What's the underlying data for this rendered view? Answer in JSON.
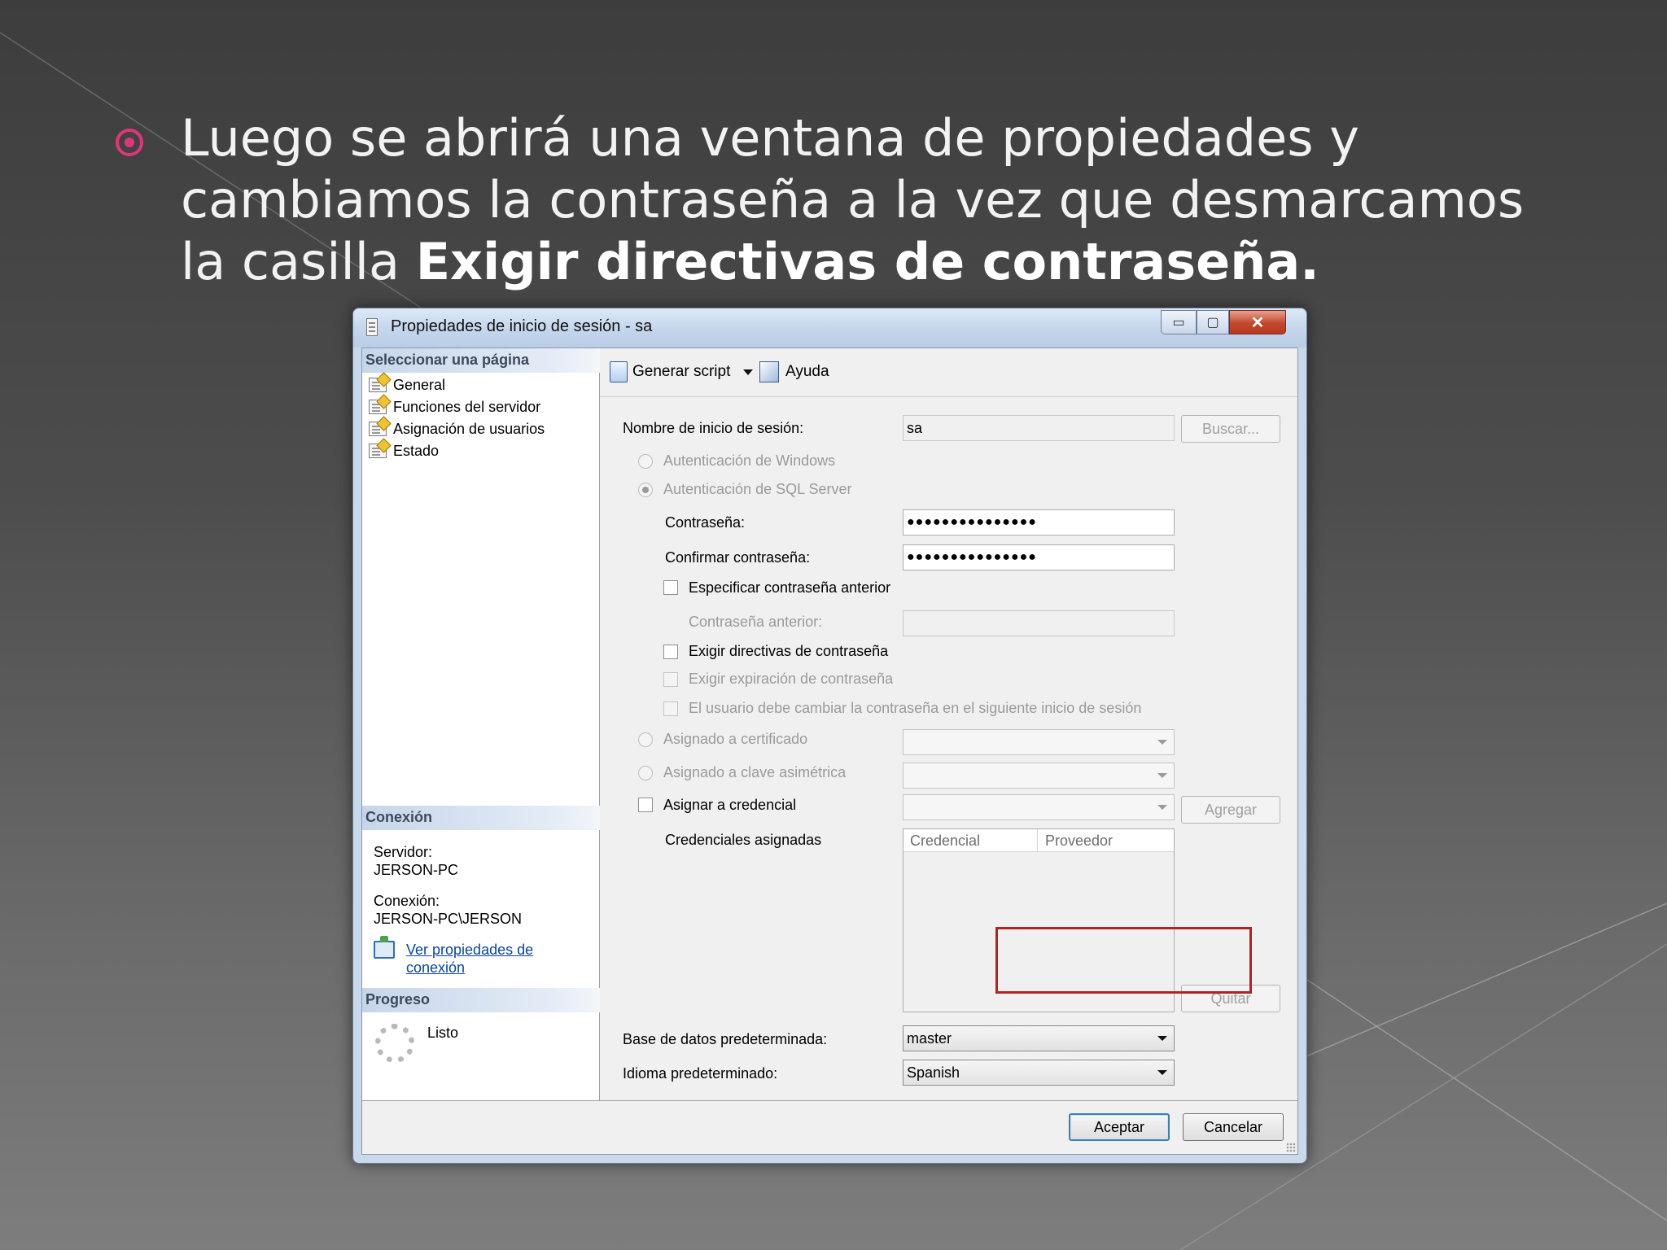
{
  "slide": {
    "text_line1": "Luego se abrirá una ventana de propiedades y",
    "text_line2": "cambiamos la contraseña a la vez que desmarcamos",
    "text_line3_prefix": "la casilla ",
    "text_line3_bold": "Exigir directivas de contraseña."
  },
  "dialog": {
    "title": "Propiedades de inicio de sesión - sa",
    "window_buttons": {
      "minimize": "▭",
      "maximize": "▢",
      "close": "✕"
    },
    "left_panel": {
      "select_page_header": "Seleccionar una página",
      "pages": [
        "General",
        "Funciones del servidor",
        "Asignación de usuarios",
        "Estado"
      ],
      "connection_header": "Conexión",
      "server_label": "Servidor:",
      "server_value": "JERSON-PC",
      "connection_label": "Conexión:",
      "connection_value": "JERSON-PC\\JERSON",
      "link_line1": "Ver propiedades de",
      "link_line2": "conexión",
      "progress_header": "Progreso",
      "progress_status": "Listo"
    },
    "toolbar": {
      "script_label": "Generar script",
      "help_label": "Ayuda"
    },
    "form": {
      "login_name_label": "Nombre de inicio de sesión:",
      "login_name_value": "sa",
      "search_button": "Buscar...",
      "windows_auth_label": "Autenticación de Windows",
      "sql_auth_label": "Autenticación de SQL Server",
      "password_label": "Contraseña:",
      "password_value": "●●●●●●●●●●●●●●●",
      "confirm_label": "Confirmar contraseña:",
      "confirm_value": "●●●●●●●●●●●●●●●",
      "specify_old_label": "Especificar contraseña anterior",
      "old_password_label": "Contraseña anterior:",
      "enforce_policy_label": "Exigir directivas de contraseña",
      "enforce_expiration_label": "Exigir expiración de contraseña",
      "must_change_label": "El usuario debe cambiar la contraseña en el siguiente inicio de sesión",
      "certificate_label": "Asignado a certificado",
      "asym_key_label": "Asignado a clave asimétrica",
      "credential_label": "Asignar a credencial",
      "add_button": "Agregar",
      "assigned_credentials_label": "Credenciales asignadas",
      "grid_col_credential": "Credencial",
      "grid_col_provider": "Proveedor",
      "remove_button": "Quitar",
      "default_db_label": "Base de datos predeterminada:",
      "default_db_value": "master",
      "default_lang_label": "Idioma predeterminado:",
      "default_lang_value": "Spanish"
    },
    "footer": {
      "ok_button": "Aceptar",
      "cancel_button": "Cancelar"
    }
  }
}
